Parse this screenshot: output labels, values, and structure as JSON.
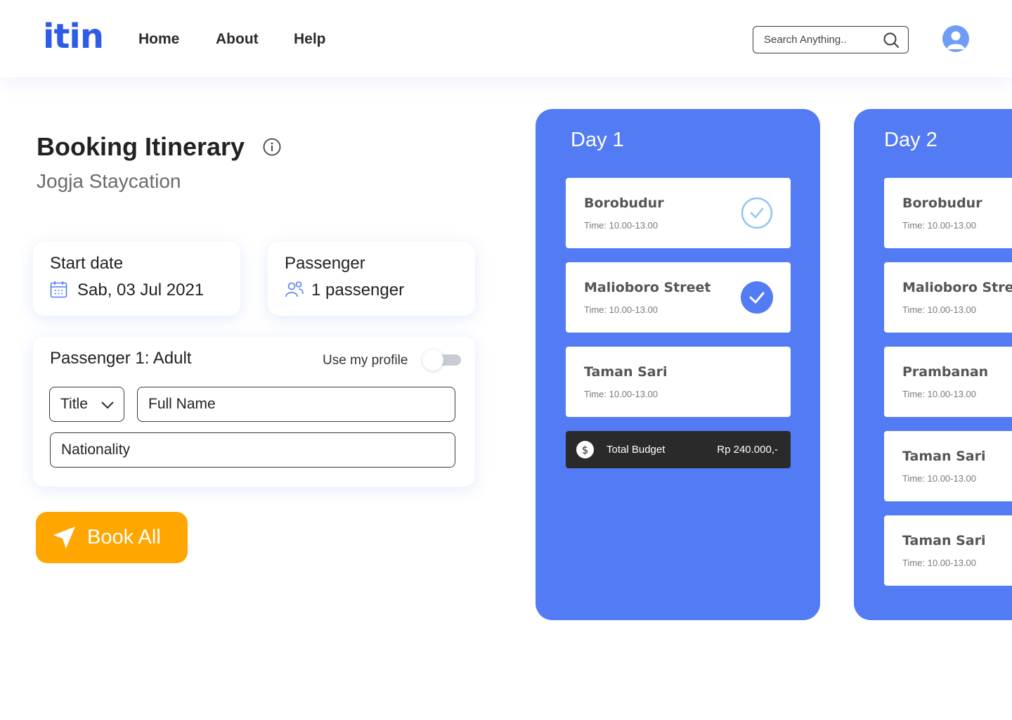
{
  "header": {
    "logo": "itin",
    "nav": [
      "Home",
      "About",
      "Help"
    ],
    "search_placeholder": "Search Anything.."
  },
  "booking": {
    "title": "Booking Itinerary",
    "subtitle": "Jogja Staycation",
    "start_date": {
      "label": "Start date",
      "value": "Sab, 03 Jul 2021"
    },
    "passenger": {
      "label": "Passenger",
      "value": "1 passenger"
    },
    "passenger_form": {
      "heading": "Passenger 1: Adult",
      "use_profile_label": "Use my profile",
      "use_profile_enabled": false,
      "title_select": "Title",
      "full_name_placeholder": "Full Name",
      "nationality_placeholder": "Nationality"
    },
    "book_button": "Book All"
  },
  "days": [
    {
      "title": "Day 1",
      "stops": [
        {
          "name": "Borobudur",
          "time": "Time: 10.00-13.00",
          "status": "outline-check"
        },
        {
          "name": "Malioboro Street",
          "time": "Time: 10.00-13.00",
          "status": "filled-check"
        },
        {
          "name": "Taman Sari",
          "time": "Time: 10.00-13.00",
          "status": "none"
        }
      ],
      "budget": {
        "label": "Total Budget",
        "value": "Rp 240.000,-"
      }
    },
    {
      "title": "Day 2",
      "stops": [
        {
          "name": "Borobudur",
          "time": "Time: 10.00-13.00"
        },
        {
          "name": "Malioboro Street",
          "time": "Time: 10.00-13.00"
        },
        {
          "name": "Prambanan",
          "time": "Time: 10.00-13.00"
        },
        {
          "name": "Taman Sari",
          "time": "Time: 10.00-13.00"
        },
        {
          "name": "Taman Sari",
          "time": "Time: 10.00-13.00"
        }
      ]
    }
  ],
  "colors": {
    "brand_blue": "#2f5ce6",
    "day_card_blue": "#537bf4",
    "cta_orange": "#ffa700",
    "budget_dark": "#2a2a2a"
  }
}
